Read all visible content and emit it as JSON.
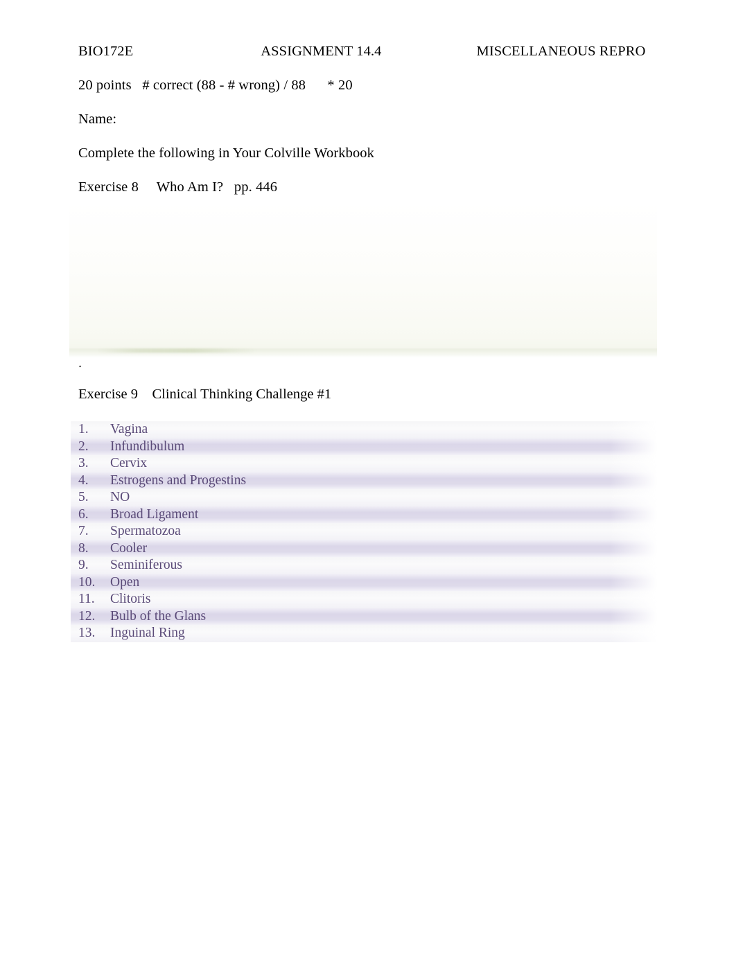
{
  "document": {
    "header": {
      "course_code": "BIO172E",
      "assignment": "ASSIGNMENT 14.4",
      "topic": "MISCELLANEOUS REPRO"
    },
    "scoring_line": "20 points   # correct (88 - # wrong) / 88      * 20",
    "name_label": "Name:",
    "instruction": "Complete the following in Your Colville Workbook",
    "exercise8_line": "Exercise 8     Who Am I?   pp. 446",
    "stray_mark": ".",
    "exercise9_line": "Exercise 9    Clinical Thinking Challenge #1"
  },
  "answers": {
    "items": [
      {
        "num": "1.",
        "text": "Vagina"
      },
      {
        "num": "2.",
        "text": "Infundibulum"
      },
      {
        "num": "3.",
        "text": "Cervix"
      },
      {
        "num": "4.",
        "text": "Estrogens and Progestins"
      },
      {
        "num": "5.",
        "text": "NO"
      },
      {
        "num": "6.",
        "text": "Broad Ligament"
      },
      {
        "num": "7.",
        "text": "Spermatozoa"
      },
      {
        "num": "8.",
        "text": "Cooler"
      },
      {
        "num": "9.",
        "text": "Seminiferous"
      },
      {
        "num": "10.",
        "text": "Open"
      },
      {
        "num": "11.",
        "text": "Clitoris"
      },
      {
        "num": "12.",
        "text": "Bulb of the Glans"
      },
      {
        "num": "13.",
        "text": "Inguinal Ring"
      }
    ]
  },
  "colors": {
    "body_text": "#000000",
    "answer_text": "#5a4a78",
    "highlight_band": "#d8d3e7",
    "alt_band": "#f5f5f7",
    "faded_image": "#f3f5eb"
  }
}
